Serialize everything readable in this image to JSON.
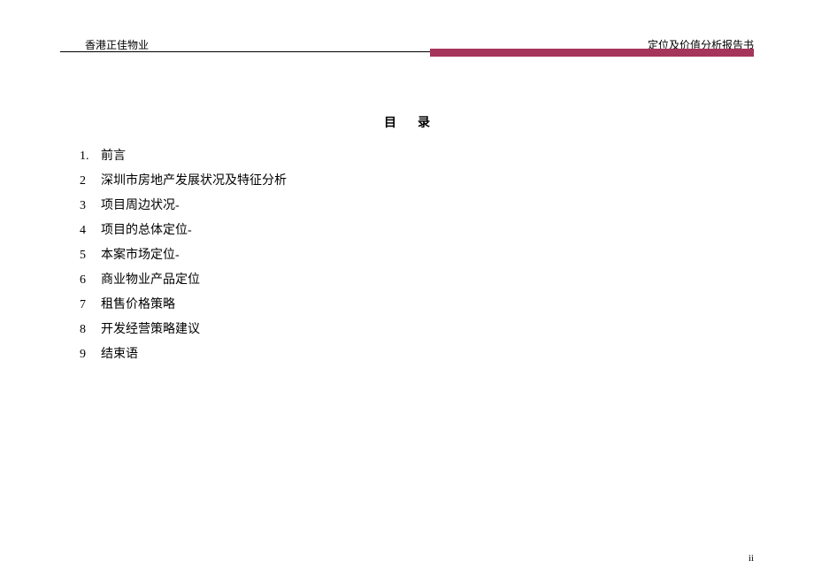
{
  "header": {
    "left": "香港正佳物业",
    "right": "定位及价值分析报告书"
  },
  "title": {
    "char1": "目",
    "char2": "录"
  },
  "toc": [
    {
      "num": "1.",
      "text": "前言"
    },
    {
      "num": "2",
      "text": "深圳市房地产发展状况及特征分析"
    },
    {
      "num": "3",
      "text": "项目周边状况-"
    },
    {
      "num": "4",
      "text": "项目的总体定位-"
    },
    {
      "num": "5",
      "text": "本案市场定位-"
    },
    {
      "num": "6",
      "text": "商业物业产品定位"
    },
    {
      "num": "7",
      "text": "租售价格策略"
    },
    {
      "num": "8",
      "text": "开发经营策略建议"
    },
    {
      "num": "9",
      "text": "结束语"
    }
  ],
  "page_number": "ii"
}
